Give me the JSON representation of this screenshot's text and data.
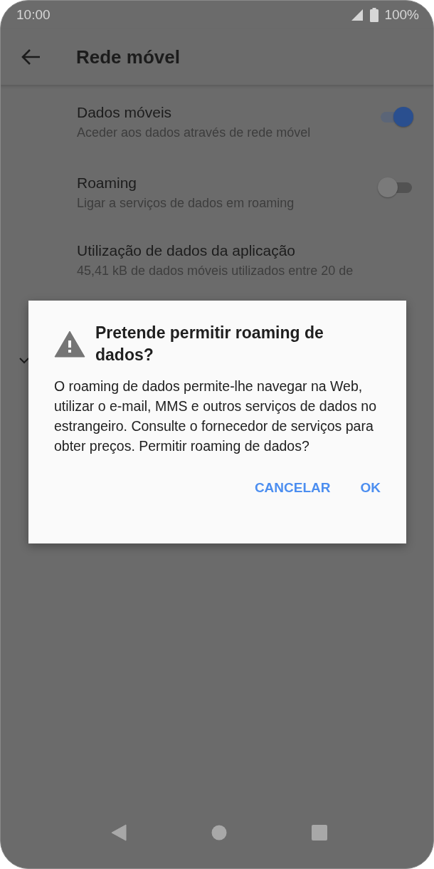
{
  "status_bar": {
    "time": "10:00",
    "battery": "100%"
  },
  "toolbar": {
    "title": "Rede móvel"
  },
  "settings": [
    {
      "kind": "switch",
      "title": "Dados móveis",
      "summary": "Aceder aos dados através de rede móvel",
      "on": true
    },
    {
      "kind": "switch",
      "title": "Roaming",
      "summary": "Ligar a serviços de dados em roaming",
      "on": false
    },
    {
      "kind": "text",
      "title": "Utilização de dados da aplicação",
      "summary": "45,41 kB de dados móveis utilizados entre 20 de"
    }
  ],
  "dialog": {
    "title": "Pretende permitir roaming de dados?",
    "message": "O roaming de dados permite-lhe navegar na Web, utilizar o e-mail, MMS e outros serviços de dados no estrangeiro. Consulte o fornecedor de serviços para obter preços. Permitir roaming de dados?",
    "buttons": [
      {
        "label": "CANCELAR"
      },
      {
        "label": "OK"
      }
    ]
  }
}
